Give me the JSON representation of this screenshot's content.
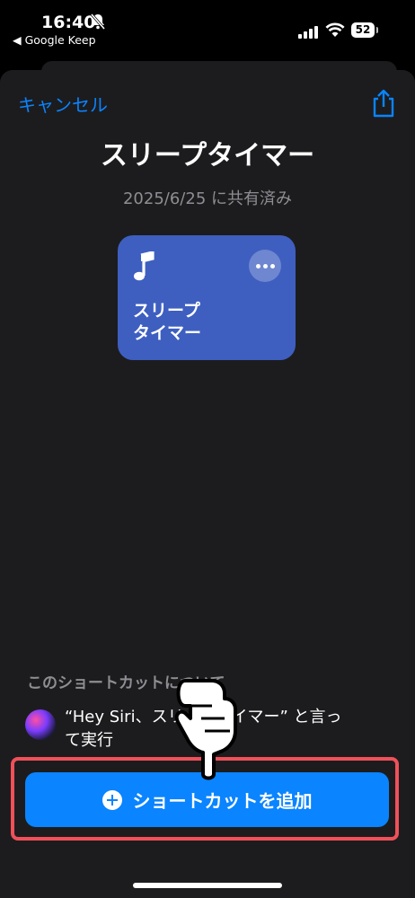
{
  "status_bar": {
    "time": "16:40",
    "back_app": "◀ Google Keep",
    "battery": "52"
  },
  "header": {
    "cancel_label": "キャンセル",
    "share_icon": "share-icon"
  },
  "shortcut": {
    "title": "スリープタイマー",
    "shared_date": "2025/6/25 に共有済み",
    "card_name": "スリープ\nタイマー",
    "card_color": "#3e5fc0",
    "card_icon": "music-note-icon"
  },
  "about": {
    "heading": "このショートカットについて",
    "siri_phrase": "“Hey Siri、スリープタイマー” と言って実行"
  },
  "actions": {
    "add_label": "ショートカットを追加",
    "accent_color": "#0a84ff",
    "highlight_color": "#f0505a"
  }
}
